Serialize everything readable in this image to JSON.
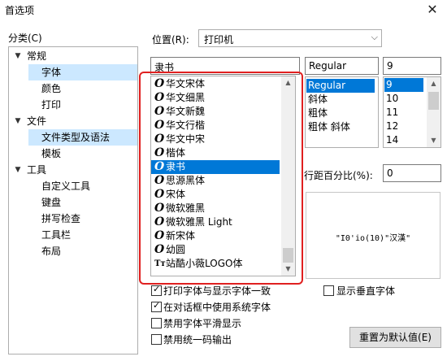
{
  "window": {
    "title": "首选项",
    "close_glyph": "✕"
  },
  "categories": {
    "label": "分类(C)",
    "items": [
      {
        "label": "常规",
        "expander": "▼",
        "selected": false
      },
      {
        "label": "字体",
        "expander": "",
        "selected": true
      },
      {
        "label": "颜色",
        "expander": "",
        "selected": false
      },
      {
        "label": "打印",
        "expander": "",
        "selected": false
      },
      {
        "label": "文件",
        "expander": "▼",
        "selected": false
      },
      {
        "label": "文件类型及语法",
        "expander": "",
        "selected": true
      },
      {
        "label": "模板",
        "expander": "",
        "selected": false
      },
      {
        "label": "工具",
        "expander": "▼",
        "selected": false
      },
      {
        "label": "自定义工具",
        "expander": "",
        "selected": false
      },
      {
        "label": "键盘",
        "expander": "",
        "selected": false
      },
      {
        "label": "拼写检查",
        "expander": "",
        "selected": false
      },
      {
        "label": "工具栏",
        "expander": "",
        "selected": false
      },
      {
        "label": "布局",
        "expander": "",
        "selected": false
      }
    ]
  },
  "position": {
    "label": "位置(R):",
    "value": "打印机",
    "arrow": "⌵"
  },
  "font": {
    "input_value": "隶书",
    "items": [
      {
        "icon": "O",
        "name": "华文宋体"
      },
      {
        "icon": "O",
        "name": "华文细黑"
      },
      {
        "icon": "O",
        "name": "华文新魏"
      },
      {
        "icon": "O",
        "name": "华文行楷"
      },
      {
        "icon": "O",
        "name": "华文中宋"
      },
      {
        "icon": "O",
        "name": "楷体"
      },
      {
        "icon": "O",
        "name": "隶书"
      },
      {
        "icon": "O",
        "name": "思源黑体"
      },
      {
        "icon": "O",
        "name": "宋体"
      },
      {
        "icon": "O",
        "name": "微软雅黑"
      },
      {
        "icon": "O",
        "name": "微软雅黑 Light"
      },
      {
        "icon": "O",
        "name": "新宋体"
      },
      {
        "icon": "O",
        "name": "幼圆"
      },
      {
        "icon": "Tт",
        "name": "站酷小薇LOGO体"
      }
    ],
    "selected_index": 6
  },
  "style": {
    "input_value": "Regular",
    "items": [
      "Regular",
      "斜体",
      "粗体",
      "粗体 斜体"
    ],
    "selected_index": 0
  },
  "size": {
    "input_value": "9",
    "items": [
      "9",
      "10",
      "11",
      "12",
      "14"
    ],
    "selected_index": 0
  },
  "line_spacing": {
    "label": "行距百分比(%):",
    "value": "0"
  },
  "preview": {
    "text": "\"I0'io(10)\"汉漢\""
  },
  "options": [
    {
      "label": "打印字体与显示字体一致",
      "checked": true
    },
    {
      "label": "在对话框中使用系统字体",
      "checked": true
    },
    {
      "label": "禁用字体平滑显示",
      "checked": false
    },
    {
      "label": "禁用统一码输出",
      "checked": false
    }
  ],
  "vertical_font": {
    "label": "显示垂直字体",
    "checked": false
  },
  "reset_button": "重置为默认值(E)",
  "colors": {
    "selection": "#0078d7",
    "highlight_frame": "#e02020",
    "tree_selection": "#cce8ff"
  }
}
